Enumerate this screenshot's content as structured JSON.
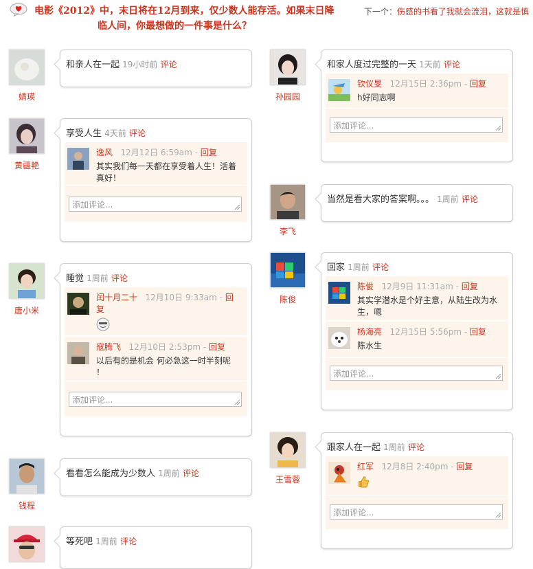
{
  "header": {
    "title_line1": "电影《2012》中，末日将在12月到来，仅少数人能存活。如果末日降",
    "title_line2": "临人间，你最想做的一件事是什么？",
    "next_prefix": "下一个：",
    "next_link": "伤感的书看了我就会流泪，这就是慎"
  },
  "colors": {
    "accent": "#c9351f",
    "comment_bg": "#fdf5ec",
    "meta": "#999999"
  },
  "comment_placeholder": "添加评论...",
  "answers": [
    {
      "user": "婧瑛",
      "text": "和亲人在一起",
      "time": "19小时前",
      "comment_label": "评论"
    },
    {
      "user": "黄疆艳",
      "text": "享受人生",
      "time": "4天前",
      "comment_label": "评论",
      "comments": [
        {
          "user": "逸风",
          "time": "12月12日 6:59am",
          "reply": "回复",
          "text1": "其实我们每一天都在享受着人生！活着",
          "text2": "真好！"
        }
      ]
    },
    {
      "user": "唐小米",
      "text": "睡觉",
      "time": "1周前",
      "comment_label": "评论",
      "comments": [
        {
          "user": "闰十月二十",
          "time": "12月10日 9:33am",
          "reply_a": "回",
          "reply_b": "复",
          "sep": "-"
        },
        {
          "user": "寇腾飞",
          "time": "12月10日 2:53pm",
          "reply": "回复",
          "text1": "以后有的是机会  何必急这一时半刻呢",
          "text2": "！"
        }
      ]
    },
    {
      "user": "钱程",
      "text": "看看怎么能成为少数人",
      "time": "1周前",
      "comment_label": "评论"
    },
    {
      "user": "",
      "text": "等死吧",
      "time": "1周前",
      "comment_label": "评论"
    },
    {
      "user": "孙园园",
      "text": "和家人度过完整的一天",
      "time": "1天前",
      "comment_label": "评论",
      "comments": [
        {
          "user": "钦仪旻",
          "time": "12月15日 2:36pm",
          "reply": "回复",
          "text1": "h好同志啊"
        }
      ]
    },
    {
      "user": "李飞",
      "text": "当然是看大家的答案啊。。。",
      "time": "1周前",
      "comment_label": "评论"
    },
    {
      "user": "陈俊",
      "text": "回家",
      "time": "1周前",
      "comment_label": "评论",
      "comments": [
        {
          "user": "陈俊",
          "time": "12月9日 11:31am",
          "reply": "回复",
          "text1": "其实学潜水是个好主意，从陆生改为水",
          "text2": "生，嗯"
        },
        {
          "user": "杨海亮",
          "time": "12月15日 5:56pm",
          "reply": "回复",
          "text1": "陈水生"
        }
      ]
    },
    {
      "user": "王雪蓉",
      "text": "跟家人在一起",
      "time": "1周前",
      "comment_label": "评论",
      "comments": [
        {
          "user": "红军",
          "time": "12月8日 2:40pm",
          "reply": "回复"
        }
      ]
    }
  ]
}
